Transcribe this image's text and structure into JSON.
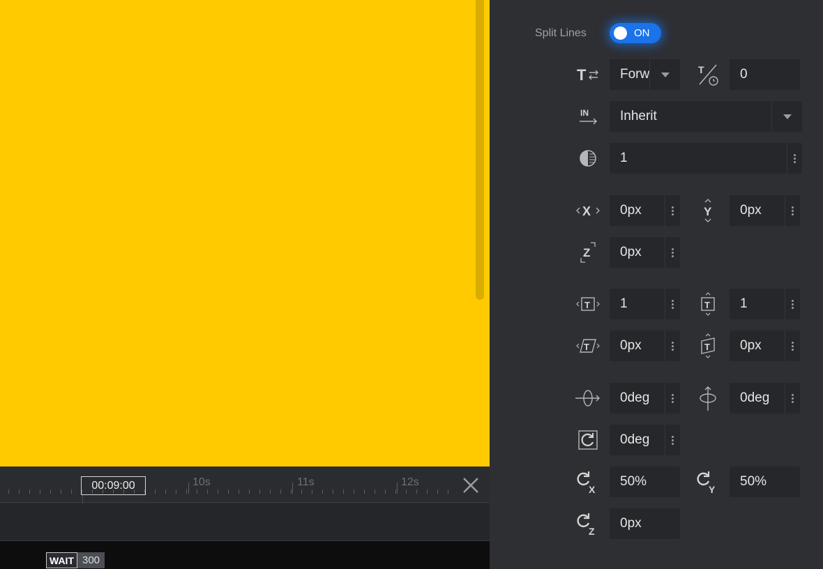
{
  "timeline": {
    "current_time": "00:09:00",
    "seconds": [
      "10s",
      "11s",
      "12s"
    ],
    "wait_label": "WAIT",
    "wait_value": "300"
  },
  "panel": {
    "split_lines": {
      "label": "Split Lines",
      "state": "ON"
    },
    "direction": {
      "value": "Forw"
    },
    "delay": {
      "value": "0"
    },
    "ease_in": {
      "value": "Inherit"
    },
    "opacity": {
      "value": "1"
    },
    "x": {
      "value": "0px"
    },
    "y": {
      "value": "0px"
    },
    "z": {
      "value": "0px"
    },
    "scale_x": {
      "value": "1"
    },
    "scale_y": {
      "value": "1"
    },
    "skew_x": {
      "value": "0px"
    },
    "skew_y": {
      "value": "0px"
    },
    "rotate_x": {
      "value": "0deg"
    },
    "rotate_y": {
      "value": "0deg"
    },
    "rotate_z": {
      "value": "0deg"
    },
    "origin_x": {
      "value": "50%"
    },
    "origin_y": {
      "value": "50%"
    },
    "origin_z": {
      "value": "0px"
    }
  },
  "colors": {
    "canvas": "#ffcb00",
    "panel": "#2e2f33",
    "toggle": "#1a73e8"
  }
}
